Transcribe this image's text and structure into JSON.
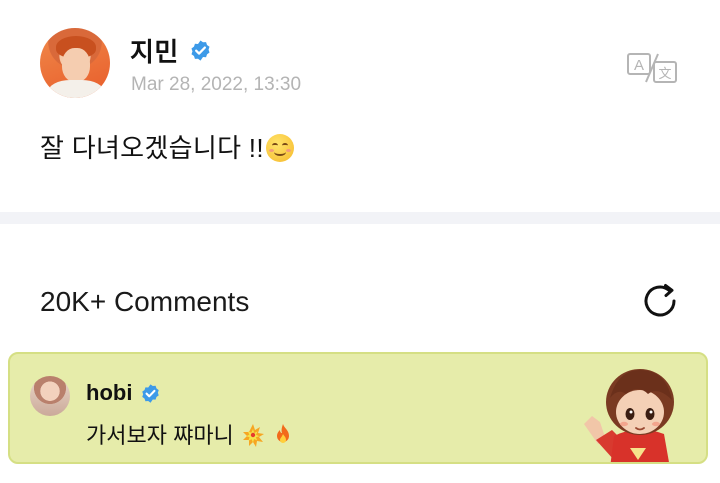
{
  "post": {
    "author": "지민",
    "timestamp": "Mar 28, 2022, 13:30",
    "text": "잘 다녀오겠습니다 !!",
    "text_emoji": "smiling-face-emoji",
    "translate_icon": "translate-icon"
  },
  "comments": {
    "title": "20K+ Comments",
    "refresh_icon": "refresh-icon",
    "highlight_color": "#e6ecaa",
    "items": [
      {
        "author": "hobi",
        "text": "가서보자 쨔마니",
        "emojis": [
          "collision-emoji",
          "fire-emoji"
        ],
        "sticker": "character-sticker"
      }
    ]
  },
  "colors": {
    "verified": "#3d9ae8",
    "timestamp": "#b4b4b4",
    "divider": "#f2f3f7"
  }
}
